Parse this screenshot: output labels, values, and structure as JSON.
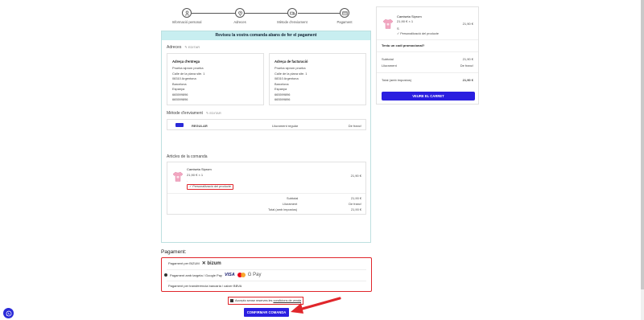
{
  "steps": [
    {
      "label": "Informació personal",
      "icon": "user-icon"
    },
    {
      "label": "Adreces",
      "icon": "location-pin-icon"
    },
    {
      "label": "Mètode d'enviament",
      "icon": "truck-icon"
    },
    {
      "label": "Pagament",
      "icon": "credit-card-icon"
    }
  ],
  "review": {
    "banner": "Reviseu la vostra comanda abans de fer el pagament",
    "addresses_title": "Adreces",
    "edit_label": "EDITAR",
    "delivery": {
      "title": "Adreça d'entrega",
      "lines": [
        "Prueba siprom prueba",
        "Calle de la plana site. 1",
        "08310 Argentona",
        "Barcelona",
        "Espanya",
        "665599896",
        "665599896"
      ]
    },
    "billing": {
      "title": "Adreça de facturació",
      "lines": [
        "Prueba siprom prueba",
        "Calle de la plana site. 1",
        "08310 Argentona",
        "Barcelona",
        "Espanya",
        "665599896",
        "665599896"
      ]
    },
    "shipping_title": "Mètode d'enviament",
    "shipping": {
      "name": "REGULAR",
      "desc": "Lliurament regular",
      "price": "De franc!"
    },
    "items_title": "Articles de la comanda",
    "item": {
      "name": "Camiseta Siprom",
      "qty": "21,90 € × 1",
      "price": "21,90 €",
      "custom": "Personalització del producte"
    },
    "totals": [
      {
        "label": "Subtotal",
        "value": "21,90 €"
      },
      {
        "label": "Lliurament",
        "value": "De franc!"
      },
      {
        "label": "Total (amb impostos)",
        "value": "21,90 €"
      }
    ]
  },
  "payment": {
    "title": "Pagament:",
    "options": [
      {
        "label": "Pagament per BIZUM",
        "selected": false
      },
      {
        "label": "Pagament amb targeta / Google Pay",
        "selected": true
      },
      {
        "label": "Pagament per transferència bancària / caixer BBVA",
        "selected": false
      }
    ],
    "bizum_text": "bizum",
    "visa_text": "VISA",
    "gpay_text": "G Pay"
  },
  "accept": {
    "prefix": "Accepto sense reserves les ",
    "link": "condicions de venda"
  },
  "confirm_label": "CONFIRMAR COMANDA",
  "cart": {
    "item_name": "Camiseta Siprom",
    "item_qty": "21,90 € × 1",
    "item_extra": "S",
    "item_price": "21,90 €",
    "item_custom": "Personalització del producte",
    "promo_label": "Teniu un codi promocional?",
    "subtotal_label": "Subtotal",
    "subtotal_value": "21,90 €",
    "delivery_label": "Lliurament",
    "delivery_value": "De franc!",
    "total_label": "Total (amb impostos)",
    "total_value": "21,90 €",
    "button_label": "VEURE EL CARRET"
  },
  "colors": {
    "accent": "#2a1ee0",
    "highlight": "#e0262b",
    "banner": "#c8eef0"
  }
}
